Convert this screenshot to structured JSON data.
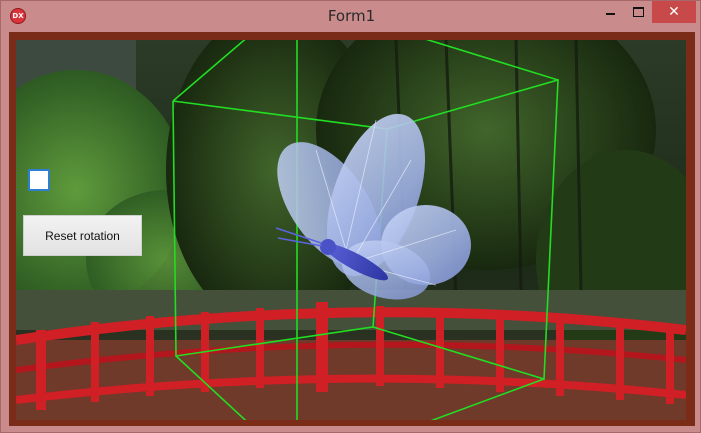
{
  "window": {
    "title": "Form1",
    "app_icon_text": "DX",
    "close_glyph": "✕"
  },
  "controls": {
    "checkbox_checked": false,
    "reset_button_label": "Reset rotation"
  },
  "icons": {
    "app": "devexpress-logo-icon",
    "minimize": "minimize-icon",
    "maximize": "maximize-icon",
    "close": "close-icon"
  },
  "colors": {
    "window_frame": "#c98b8b",
    "client_border": "#7a2c18",
    "gizmo": "#22dd22",
    "bridge": "#d01f25",
    "butterfly": "#a6b8e8"
  }
}
